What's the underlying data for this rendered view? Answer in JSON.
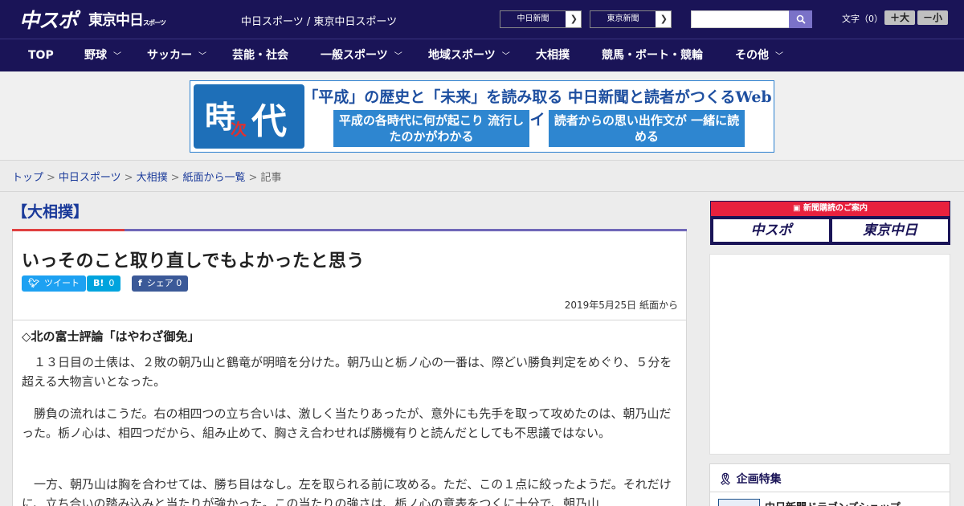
{
  "header": {
    "logo_main": "中スポ",
    "logo_tokyo": "東京中日",
    "logo_tokyo_small": "スポーツ",
    "site_links": "中日スポーツ / 東京中日スポーツ",
    "btn_chunichi": "中日新聞",
    "btn_tokyo": "東京新聞",
    "fontsize_label": "文字（0）",
    "font_larger": "＋大",
    "font_smaller": "－小"
  },
  "nav": {
    "items": [
      {
        "label": "TOP"
      },
      {
        "label": "野球"
      },
      {
        "label": "サッカー"
      },
      {
        "label": "芸能・社会"
      },
      {
        "label": "一般スポーツ"
      },
      {
        "label": "地域スポーツ"
      },
      {
        "label": "大相撲"
      },
      {
        "label": "競馬・ボート・競輪"
      },
      {
        "label": "その他"
      }
    ]
  },
  "banner": {
    "char1": "時",
    "char2": "次",
    "char3": "代",
    "headline": "「平成」の歴史と「未来」を読み取る 中日新聞と読者がつくるWebサイト",
    "box_left": "平成の各時代に何が起こり 流行したのかがわかる",
    "box_right": "読者からの思い出作文が 一緒に読める"
  },
  "breadcrumb": {
    "items": [
      "トップ",
      "中日スポーツ",
      "大相撲",
      "紙面から一覧"
    ],
    "current": "記事"
  },
  "article": {
    "category": "【大相撲】",
    "title": "いっそのこと取り直しでもよかったと思う",
    "tweet_label": "ツイート",
    "hatena_label": "0",
    "facebook_label": "シェア 0",
    "date": "2019年5月25日 紙面から",
    "subtitle": "◇北の富士評論「はやわざ御免」",
    "paragraphs": [
      "　１３日目の土俵は、２敗の朝乃山と鶴竜が明暗を分けた。朝乃山と栃ノ心の一番は、際どい勝負判定をめぐり、５分を超える大物言いとなった。",
      "　勝負の流れはこうだ。右の相四つの立ち合いは、激しく当たりあったが、意外にも先手を取って攻めたのは、朝乃山だった。栃ノ心は、相四つだから、組み止めて、胸さえ合わせれば勝機有りと読んだとしても不思議ではない。",
      "　一方、朝乃山は胸を合わせては、勝ち目はなし。左を取られる前に攻める。ただ、この１点に絞ったようだ。それだけに、立ち合いの踏み込みと当たりが強かった。この当たりの強さは、栃ノ心の意表をつくに十分で、朝乃山"
    ]
  },
  "sidebar": {
    "subscribe_header": "新聞購読のご案内",
    "sub_left": "中スポ",
    "sub_right": "東京中日",
    "feature_title": "企画特集",
    "feature_item": "中日新聞ドラゴンズショップ"
  },
  "colors": {
    "navy": "#1a1457",
    "accent_purple": "#7067b8",
    "accent_red": "#e04040",
    "twitter": "#1da1f2",
    "hatena": "#00a4de",
    "facebook": "#3b5998"
  }
}
